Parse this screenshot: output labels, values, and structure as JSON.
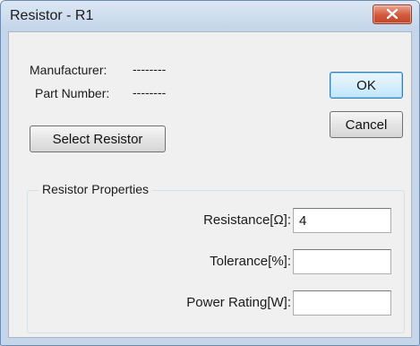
{
  "window": {
    "title": "Resistor - R1"
  },
  "info": {
    "manufacturer_label": "Manufacturer:",
    "manufacturer_value": "--------",
    "part_number_label": "Part Number:",
    "part_number_value": "--------"
  },
  "buttons": {
    "select_resistor": "Select Resistor",
    "ok": "OK",
    "cancel": "Cancel"
  },
  "properties": {
    "group_title": "Resistor Properties",
    "resistance_label": "Resistance[Ω]:",
    "resistance_value": "4",
    "tolerance_label": "Tolerance[%]:",
    "tolerance_value": "",
    "power_rating_label": "Power Rating[W]:",
    "power_rating_value": ""
  },
  "icons": {
    "close": "close-icon"
  },
  "colors": {
    "title_bar": "#c9d9ee",
    "close_button": "#d2583c",
    "dialog_background": "#f0f0f0",
    "default_button_border": "#3c7fb1"
  }
}
